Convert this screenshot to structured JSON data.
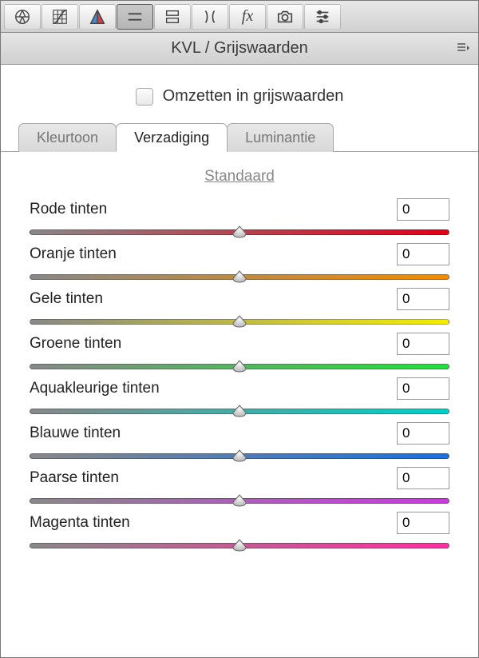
{
  "toolbar": {
    "icons": [
      "aperture-icon",
      "curves-icon",
      "split-tone-icon",
      "detail-icon",
      "noise-icon",
      "lens-icon",
      "fx-icon",
      "camera-icon",
      "sliders-icon"
    ],
    "active_index": 3
  },
  "header": {
    "title": "KVL / Grijswaarden"
  },
  "grayscale": {
    "label": "Omzetten in grijswaarden",
    "checked": false
  },
  "tabs": {
    "items": [
      "Kleurtoon",
      "Verzadiging",
      "Luminantie"
    ],
    "active_index": 1
  },
  "defaults_link": "Standaard",
  "sliders": [
    {
      "label": "Rode tinten",
      "value": "0",
      "gradient": [
        "#888888",
        "#e2001a"
      ]
    },
    {
      "label": "Oranje tinten",
      "value": "0",
      "gradient": [
        "#888888",
        "#f28c00"
      ]
    },
    {
      "label": "Gele tinten",
      "value": "0",
      "gradient": [
        "#888888",
        "#f5ee00"
      ]
    },
    {
      "label": "Groene tinten",
      "value": "0",
      "gradient": [
        "#888888",
        "#22e03a"
      ]
    },
    {
      "label": "Aquakleurige tinten",
      "value": "0",
      "gradient": [
        "#888888",
        "#00d1c6"
      ]
    },
    {
      "label": "Blauwe tinten",
      "value": "0",
      "gradient": [
        "#888888",
        "#1a6fe0"
      ]
    },
    {
      "label": "Paarse tinten",
      "value": "0",
      "gradient": [
        "#888888",
        "#c93ae0"
      ]
    },
    {
      "label": "Magenta tinten",
      "value": "0",
      "gradient": [
        "#888888",
        "#ff2ea0"
      ]
    }
  ]
}
